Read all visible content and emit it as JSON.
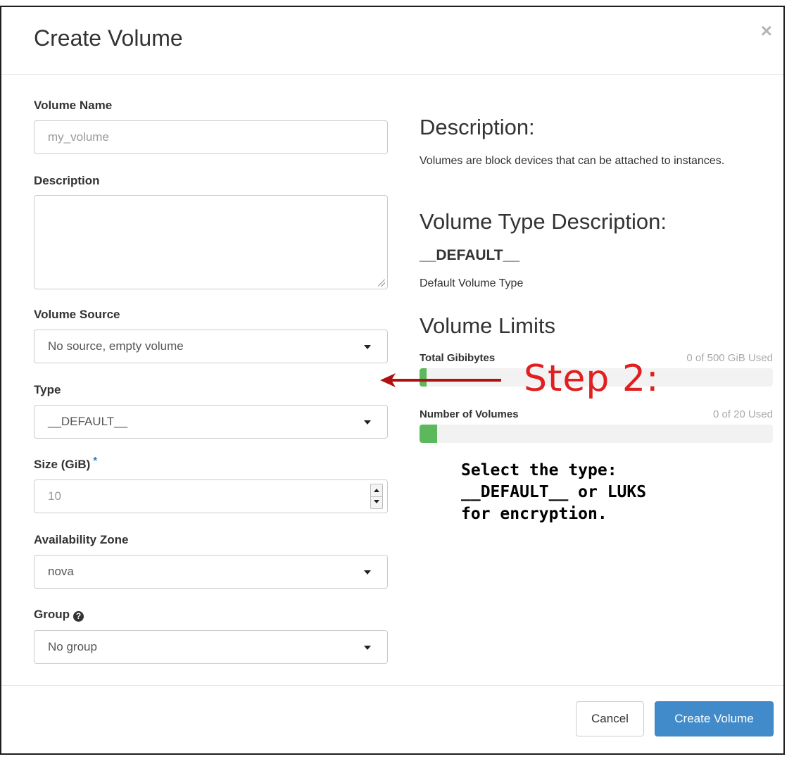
{
  "modal": {
    "title": "Create Volume",
    "close_symbol": "×"
  },
  "form": {
    "volume_name": {
      "label": "Volume Name",
      "placeholder": "my_volume",
      "value": ""
    },
    "description": {
      "label": "Description",
      "value": ""
    },
    "volume_source": {
      "label": "Volume Source",
      "selected": "No source, empty volume"
    },
    "type": {
      "label": "Type",
      "selected": "__DEFAULT__"
    },
    "size": {
      "label": "Size (GiB)",
      "required_marker": "*",
      "placeholder": "10",
      "value": ""
    },
    "availability_zone": {
      "label": "Availability Zone",
      "selected": "nova"
    },
    "group": {
      "label": "Group",
      "help_icon": "question-circle-icon",
      "help_glyph": "?",
      "selected": "No group"
    }
  },
  "info": {
    "description_heading": "Description:",
    "description_text": "Volumes are block devices that can be attached to instances.",
    "type_heading": "Volume Type Description:",
    "type_name": "__DEFAULT__",
    "type_text": "Default Volume Type",
    "limits_heading": "Volume Limits",
    "limits": [
      {
        "label": "Total Gibibytes",
        "value_text": "0 of 500 GiB Used",
        "fill_percent": 2
      },
      {
        "label": "Number of Volumes",
        "value_text": "0 of 20 Used",
        "fill_percent": 5
      }
    ]
  },
  "annotation": {
    "step_label": "Step 2:",
    "note_lines": "Select the type:\n__DEFAULT__ or LUKS\nfor encryption.",
    "arrow_color": "#b01010",
    "step_color": "#e02020"
  },
  "footer": {
    "cancel_label": "Cancel",
    "submit_label": "Create Volume"
  },
  "colors": {
    "primary": "#428bca",
    "progress": "#5cb85c",
    "required": "#1e7fd1"
  }
}
